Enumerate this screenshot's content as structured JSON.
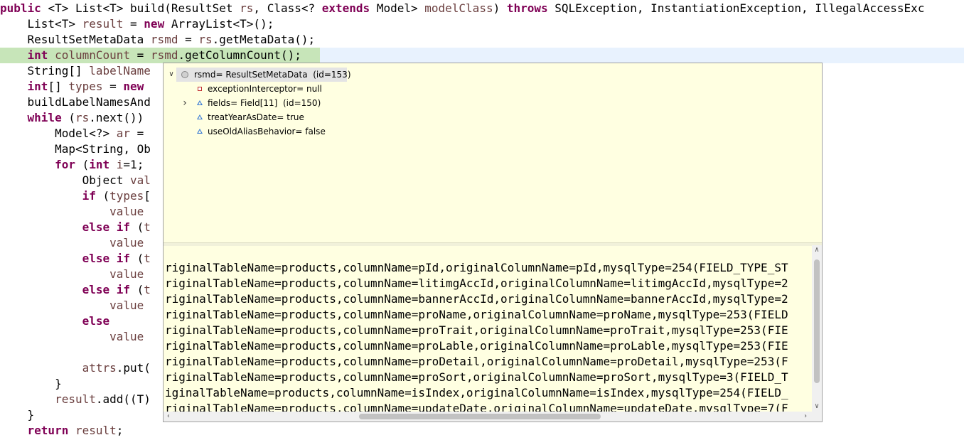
{
  "editor": {
    "lines": [
      {
        "tokens": [
          {
            "t": "public ",
            "c": "kw"
          },
          {
            "t": "<T> List<T> build(ResultSet ",
            "c": "plain"
          },
          {
            "t": "rs",
            "c": "var"
          },
          {
            "t": ", Class<? ",
            "c": "plain"
          },
          {
            "t": "extends",
            "c": "kw"
          },
          {
            "t": " Model> ",
            "c": "plain"
          },
          {
            "t": "modelClass",
            "c": "var"
          },
          {
            "t": ") ",
            "c": "plain"
          },
          {
            "t": "throws",
            "c": "kw"
          },
          {
            "t": " SQLException, InstantiationException, IllegalAccessExc",
            "c": "plain"
          }
        ]
      },
      {
        "tokens": [
          {
            "t": "    List<T> ",
            "c": "plain"
          },
          {
            "t": "result",
            "c": "var"
          },
          {
            "t": " = ",
            "c": "plain"
          },
          {
            "t": "new",
            "c": "kw"
          },
          {
            "t": " ArrayList<T>();",
            "c": "plain"
          }
        ]
      },
      {
        "tokens": [
          {
            "t": "    ResultSetMetaData ",
            "c": "plain"
          },
          {
            "t": "rsmd",
            "c": "var"
          },
          {
            "t": " = ",
            "c": "plain"
          },
          {
            "t": "rs",
            "c": "var"
          },
          {
            "t": ".getMetaData();",
            "c": "plain"
          }
        ]
      },
      {
        "current": true,
        "tokens": [
          {
            "t": "    ",
            "c": "plain"
          },
          {
            "t": "int",
            "c": "kw"
          },
          {
            "t": " ",
            "c": "plain"
          },
          {
            "t": "columnCount",
            "c": "var"
          },
          {
            "t": " = ",
            "c": "plain"
          },
          {
            "t": "rsmd",
            "c": "var"
          },
          {
            "t": ".getColumnCount();",
            "c": "plain"
          }
        ]
      },
      {
        "tokens": [
          {
            "t": "    String[] ",
            "c": "plain"
          },
          {
            "t": "labelName",
            "c": "var"
          }
        ]
      },
      {
        "tokens": [
          {
            "t": "    ",
            "c": "plain"
          },
          {
            "t": "int",
            "c": "kw"
          },
          {
            "t": "[] ",
            "c": "plain"
          },
          {
            "t": "types",
            "c": "var"
          },
          {
            "t": " = ",
            "c": "plain"
          },
          {
            "t": "new",
            "c": "kw"
          }
        ]
      },
      {
        "tokens": [
          {
            "t": "    buildLabelNamesAnd",
            "c": "plain"
          }
        ]
      },
      {
        "tokens": [
          {
            "t": "    ",
            "c": "plain"
          },
          {
            "t": "while",
            "c": "kw"
          },
          {
            "t": " (",
            "c": "plain"
          },
          {
            "t": "rs",
            "c": "var"
          },
          {
            "t": ".next())",
            "c": "plain"
          }
        ]
      },
      {
        "tokens": [
          {
            "t": "        Model<?> ",
            "c": "plain"
          },
          {
            "t": "ar",
            "c": "var"
          },
          {
            "t": " =",
            "c": "plain"
          }
        ]
      },
      {
        "tokens": [
          {
            "t": "        Map<String, Ob",
            "c": "plain"
          }
        ]
      },
      {
        "tokens": [
          {
            "t": "        ",
            "c": "plain"
          },
          {
            "t": "for",
            "c": "kw"
          },
          {
            "t": " (",
            "c": "plain"
          },
          {
            "t": "int",
            "c": "kw"
          },
          {
            "t": " ",
            "c": "plain"
          },
          {
            "t": "i",
            "c": "var"
          },
          {
            "t": "=1;",
            "c": "plain"
          }
        ]
      },
      {
        "tokens": [
          {
            "t": "            Object ",
            "c": "plain"
          },
          {
            "t": "val",
            "c": "var"
          }
        ]
      },
      {
        "tokens": [
          {
            "t": "            ",
            "c": "plain"
          },
          {
            "t": "if",
            "c": "kw"
          },
          {
            "t": " (",
            "c": "plain"
          },
          {
            "t": "types",
            "c": "var"
          },
          {
            "t": "[",
            "c": "plain"
          }
        ]
      },
      {
        "tokens": [
          {
            "t": "                ",
            "c": "plain"
          },
          {
            "t": "value",
            "c": "var"
          }
        ]
      },
      {
        "tokens": [
          {
            "t": "            ",
            "c": "plain"
          },
          {
            "t": "else if",
            "c": "kw"
          },
          {
            "t": " (",
            "c": "plain"
          },
          {
            "t": "t",
            "c": "var"
          }
        ]
      },
      {
        "tokens": [
          {
            "t": "                ",
            "c": "plain"
          },
          {
            "t": "value",
            "c": "var"
          }
        ]
      },
      {
        "tokens": [
          {
            "t": "            ",
            "c": "plain"
          },
          {
            "t": "else if",
            "c": "kw"
          },
          {
            "t": " (",
            "c": "plain"
          },
          {
            "t": "t",
            "c": "var"
          }
        ]
      },
      {
        "tokens": [
          {
            "t": "                ",
            "c": "plain"
          },
          {
            "t": "value",
            "c": "var"
          }
        ]
      },
      {
        "tokens": [
          {
            "t": "            ",
            "c": "plain"
          },
          {
            "t": "else if",
            "c": "kw"
          },
          {
            "t": " (",
            "c": "plain"
          },
          {
            "t": "t",
            "c": "var"
          }
        ]
      },
      {
        "tokens": [
          {
            "t": "                ",
            "c": "plain"
          },
          {
            "t": "value",
            "c": "var"
          }
        ]
      },
      {
        "tokens": [
          {
            "t": "            ",
            "c": "plain"
          },
          {
            "t": "else",
            "c": "kw"
          }
        ]
      },
      {
        "tokens": [
          {
            "t": "                ",
            "c": "plain"
          },
          {
            "t": "value",
            "c": "var"
          }
        ]
      },
      {
        "tokens": []
      },
      {
        "tokens": [
          {
            "t": "            ",
            "c": "plain"
          },
          {
            "t": "attrs",
            "c": "var"
          },
          {
            "t": ".put(",
            "c": "plain"
          }
        ]
      },
      {
        "tokens": [
          {
            "t": "        }",
            "c": "plain"
          }
        ]
      },
      {
        "tokens": [
          {
            "t": "        ",
            "c": "plain"
          },
          {
            "t": "result",
            "c": "var"
          },
          {
            "t": ".add((T)",
            "c": "plain"
          }
        ]
      },
      {
        "tokens": [
          {
            "t": "    }",
            "c": "plain"
          }
        ]
      },
      {
        "tokens": [
          {
            "t": "    ",
            "c": "plain"
          },
          {
            "t": "return",
            "c": "kw"
          },
          {
            "t": " ",
            "c": "plain"
          },
          {
            "t": "result",
            "c": "var"
          },
          {
            "t": ";",
            "c": "plain"
          }
        ]
      }
    ]
  },
  "hover": {
    "root": {
      "label": "rsmd= ResultSetMetaData  (id=153)",
      "icon": "object-icon",
      "expanded": true
    },
    "fields": [
      {
        "label": "exceptionInterceptor= null",
        "icon": "private-field-icon",
        "expandable": false
      },
      {
        "label": "fields= Field[11]  (id=150)",
        "icon": "protected-field-icon",
        "expandable": true
      },
      {
        "label": "treatYearAsDate= true",
        "icon": "protected-field-icon",
        "expandable": false
      },
      {
        "label": "useOldAliasBehavior= false",
        "icon": "protected-field-icon",
        "expandable": false
      }
    ],
    "detail_lines": [
      "riginalTableName=products,columnName=pId,originalColumnName=pId,mysqlType=254(FIELD_TYPE_ST",
      "riginalTableName=products,columnName=litimgAccId,originalColumnName=litimgAccId,mysqlType=2",
      "riginalTableName=products,columnName=bannerAccId,originalColumnName=bannerAccId,mysqlType=2",
      "riginalTableName=products,columnName=proName,originalColumnName=proName,mysqlType=253(FIELD",
      "riginalTableName=products,columnName=proTrait,originalColumnName=proTrait,mysqlType=253(FIE",
      "riginalTableName=products,columnName=proLable,originalColumnName=proLable,mysqlType=253(FIE",
      "riginalTableName=products,columnName=proDetail,originalColumnName=proDetail,mysqlType=253(F",
      "riginalTableName=products,columnName=proSort,originalColumnName=proSort,mysqlType=3(FIELD_T",
      "iginalTableName=products,columnName=isIndex,originalColumnName=isIndex,mysqlType=254(FIELD_",
      "riginalTableName=products,columnName=updateDate,originalColumnName=updateDate,mysqlType=7(F"
    ]
  },
  "colors": {
    "keyword": "#7f0055",
    "variable": "#6a3e3e",
    "hover_bg": "#ffffe1",
    "current_line": "#e8f2fe"
  }
}
